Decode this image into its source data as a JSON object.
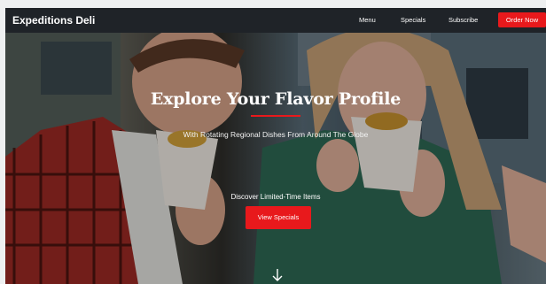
{
  "nav": {
    "brand": "Expeditions Deli",
    "links": [
      "Menu",
      "Specials",
      "Subscribe"
    ],
    "cta": "Order Now"
  },
  "hero": {
    "title": "Explore Your Flavor Profile",
    "subtitle": "With Rotating Regional Dishes From Around The Globe",
    "discover": "Discover Limited-Time Items",
    "button": "View Specials",
    "scroll_icon": "arrow-down-icon"
  },
  "colors": {
    "accent": "#e8191c",
    "nav_bg": "#1f2328"
  }
}
